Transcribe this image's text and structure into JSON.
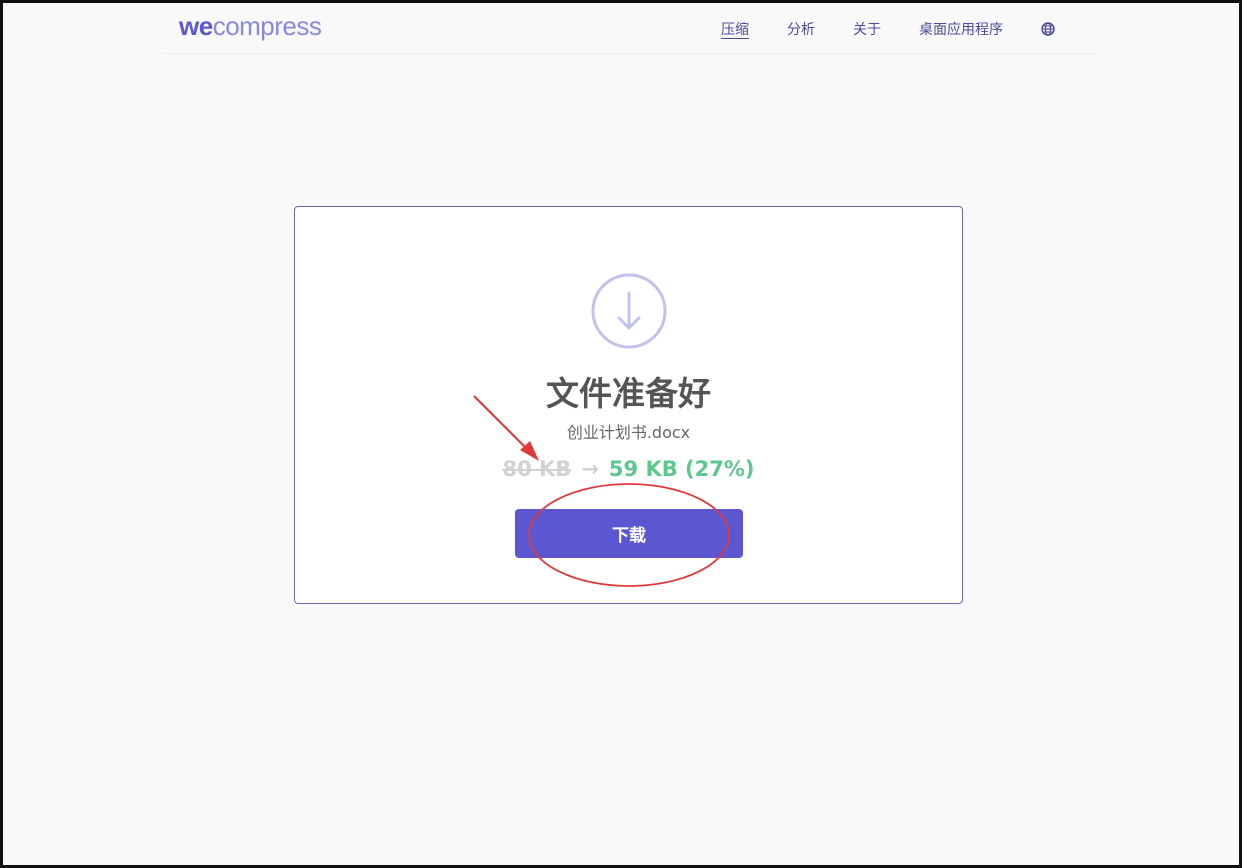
{
  "header": {
    "logo_we": "we",
    "logo_compress": "compress",
    "nav": [
      {
        "label": "压缩",
        "active": true
      },
      {
        "label": "分析",
        "active": false
      },
      {
        "label": "关于",
        "active": false
      },
      {
        "label": "桌面应用程序",
        "active": false
      }
    ],
    "language_icon": "globe-icon"
  },
  "result": {
    "icon": "download-circle-icon",
    "title": "文件准备好",
    "filename": "创业计划书.docx",
    "original_size": "80 KB",
    "arrow": "→",
    "compressed_size": "59 KB (27%)",
    "download_label": "下载"
  },
  "colors": {
    "brand": "#5b57d1",
    "success": "#5cc88e",
    "annotation": "#e03a3a"
  }
}
